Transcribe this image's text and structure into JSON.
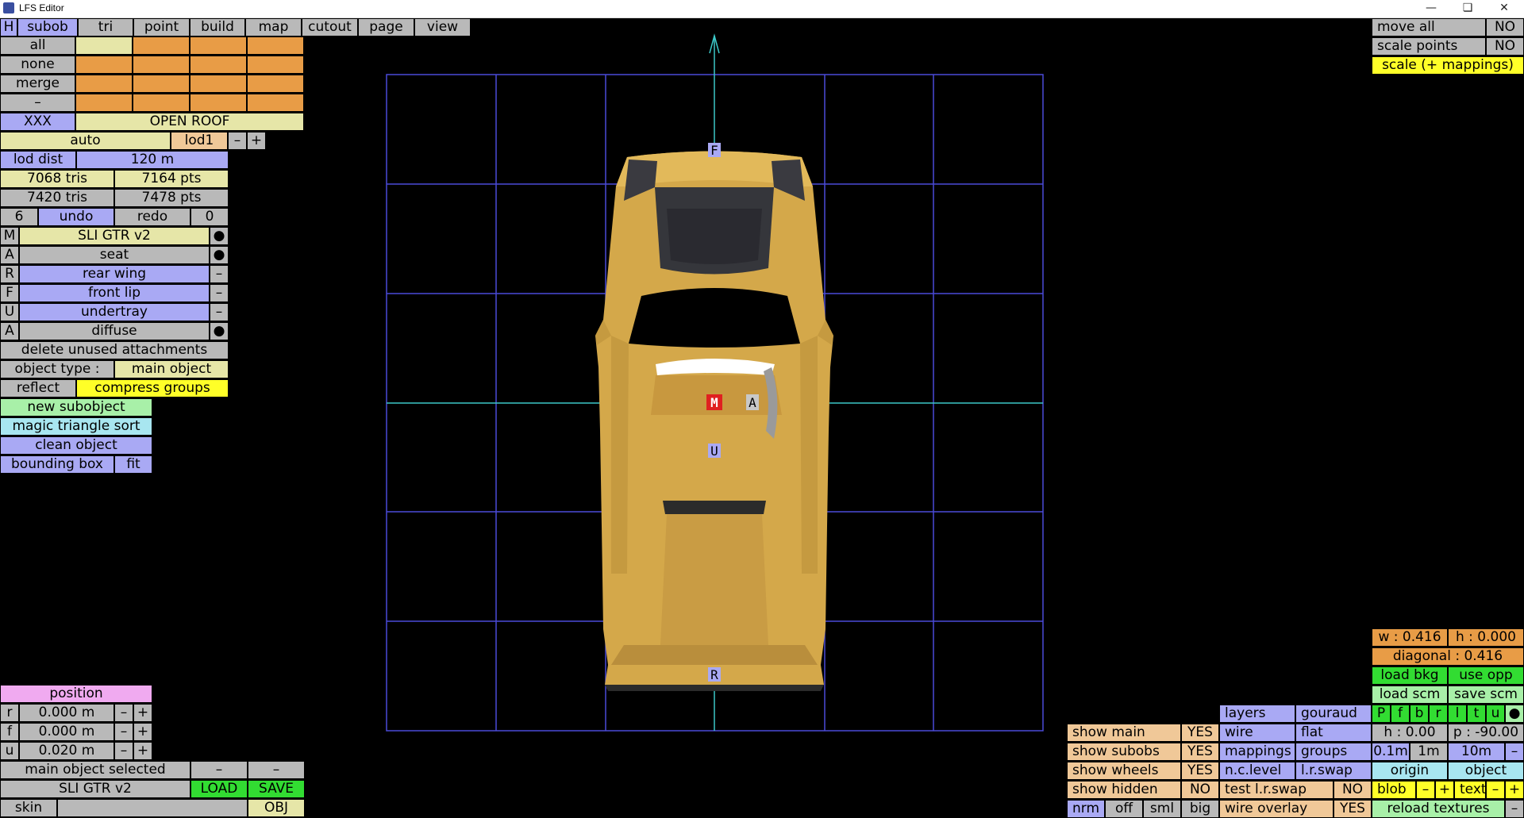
{
  "window": {
    "title": "LFS Editor",
    "min_icon": "minimize-icon",
    "max_icon": "restore-icon",
    "close_icon": "close-icon"
  },
  "menu": {
    "h": "H",
    "tabs": [
      "subob",
      "tri",
      "point",
      "build",
      "map",
      "cutout",
      "page",
      "view"
    ]
  },
  "select": {
    "all": "all",
    "none": "none",
    "merge": "merge",
    "dash": "–",
    "xxx": "XXX",
    "open_roof": "OPEN ROOF"
  },
  "lod": {
    "auto": "auto",
    "lod": "lod1",
    "minus": "–",
    "plus": "+",
    "dist_label": "lod dist",
    "dist_value": "120 m"
  },
  "stats": {
    "tris1": "7068 tris",
    "pts1": "7164 pts",
    "tris2": "7420 tris",
    "pts2": "7478 pts"
  },
  "history": {
    "count": "6",
    "undo": "undo",
    "redo": "redo",
    "redo_count": "0"
  },
  "subobjects": [
    {
      "key": "M",
      "name": "SLI GTR v2",
      "mark": "●",
      "color": "y"
    },
    {
      "key": "A",
      "name": "seat",
      "mark": "●",
      "color": "g"
    },
    {
      "key": "R",
      "name": "rear wing",
      "mark": "–",
      "color": "b"
    },
    {
      "key": "F",
      "name": "front lip",
      "mark": "–",
      "color": "b"
    },
    {
      "key": "U",
      "name": "undertray",
      "mark": "–",
      "color": "b"
    },
    {
      "key": "A",
      "name": "diffuse",
      "mark": "●",
      "color": "g"
    }
  ],
  "actions": {
    "delete_unused": "delete unused attachments",
    "object_type_label": "object type :",
    "object_type_value": "main object",
    "reflect": "reflect",
    "compress_groups": "compress groups",
    "new_subobject": "new subobject",
    "magic_sort": "magic triangle sort",
    "clean_object": "clean object",
    "bounding_box": "bounding box",
    "fit": "fit"
  },
  "position": {
    "title": "position",
    "rows": [
      {
        "axis": "r",
        "value": "0.000 m"
      },
      {
        "axis": "f",
        "value": "0.000 m"
      },
      {
        "axis": "u",
        "value": "0.020 m"
      }
    ],
    "minus": "–",
    "plus": "+"
  },
  "bottom_left": {
    "status": "main object selected",
    "dash1": "–",
    "dash2": "–",
    "object_name": "SLI GTR v2",
    "load": "LOAD",
    "save": "SAVE",
    "skin": "skin",
    "skin_value": "",
    "obj": "OBJ"
  },
  "top_right": {
    "move_all": "move all",
    "move_all_value": "NO",
    "scale_points": "scale points",
    "scale_points_value": "NO",
    "scale_mappings": "scale (+ mappings)"
  },
  "dims": {
    "w": "w : 0.416",
    "h": "h : 0.000",
    "diagonal": "diagonal : 0.416"
  },
  "bkg": {
    "load_bkg": "load bkg",
    "use_opp": "use opp",
    "load_scm": "load scm",
    "save_scm": "save scm"
  },
  "view_letters": [
    "P",
    "f",
    "b",
    "r",
    "l",
    "t",
    "u",
    "●"
  ],
  "camera": {
    "h": "h : 0.00",
    "p": "p : -90.00"
  },
  "scale_buttons": [
    "0.1m",
    "1m",
    "10m",
    "–"
  ],
  "origin": "origin",
  "object": "object",
  "blob": "blob",
  "text": "text",
  "minus": "–",
  "plus": "+",
  "reload_textures": "reload textures",
  "reload_minus": "–",
  "display": {
    "show_main": "show main",
    "show_main_v": "YES",
    "show_subobs": "show subobs",
    "show_subobs_v": "YES",
    "show_wheels": "show wheels",
    "show_wheels_v": "YES",
    "show_hidden": "show hidden",
    "show_hidden_v": "NO",
    "layers": "layers",
    "gouraud": "gouraud",
    "wire": "wire",
    "flat": "flat",
    "mappings": "mappings",
    "groups": "groups",
    "nc_level": "n.c.level",
    "lr_swap": "l.r.swap",
    "test_lr_swap": "test l.r.swap",
    "test_lr_swap_v": "NO",
    "wire_overlay": "wire overlay",
    "wire_overlay_v": "YES",
    "nrm": "nrm",
    "off": "off",
    "sml": "sml",
    "big": "big"
  },
  "viewport": {
    "markers": [
      "F",
      "M",
      "A",
      "U",
      "R"
    ]
  }
}
